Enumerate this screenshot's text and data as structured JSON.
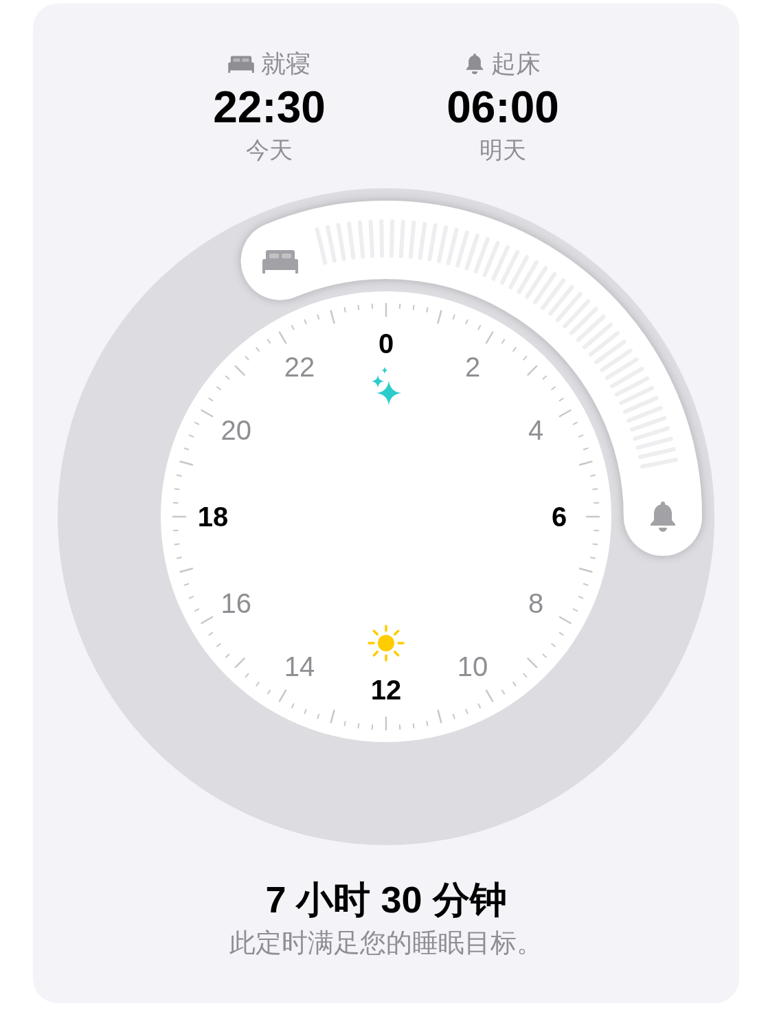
{
  "schedule": [
    {
      "kind": "bedtime",
      "label": "就寝",
      "time": "22:30",
      "day": "今天"
    },
    {
      "kind": "wake",
      "label": "起床",
      "time": "06:00",
      "day": "明天"
    }
  ],
  "clock": {
    "hour_labels": [
      {
        "text": "0",
        "kind": "major"
      },
      {
        "text": "2",
        "kind": "minor"
      },
      {
        "text": "4",
        "kind": "minor"
      },
      {
        "text": "6",
        "kind": "major"
      },
      {
        "text": "8",
        "kind": "minor"
      },
      {
        "text": "10",
        "kind": "minor"
      },
      {
        "text": "12",
        "kind": "major"
      },
      {
        "text": "14",
        "kind": "minor"
      },
      {
        "text": "16",
        "kind": "minor"
      },
      {
        "text": "18",
        "kind": "major"
      },
      {
        "text": "20",
        "kind": "minor"
      },
      {
        "text": "22",
        "kind": "minor"
      }
    ]
  },
  "summary": {
    "duration": "7 小时 30 分钟",
    "note": "此定时满足您的睡眠目标。"
  }
}
